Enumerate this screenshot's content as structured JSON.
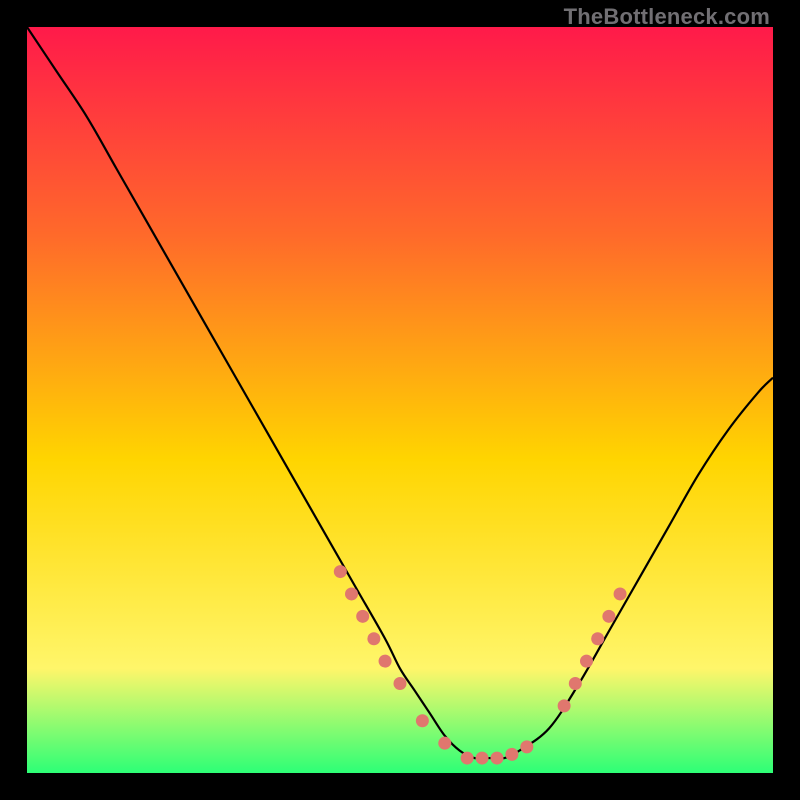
{
  "watermark": "TheBottleneck.com",
  "colors": {
    "gradient_top": "#ff1a4a",
    "gradient_mid_upper": "#ff6a2a",
    "gradient_mid": "#ffd500",
    "gradient_lower": "#fff66a",
    "gradient_bottom": "#2dff76",
    "curve": "#000000",
    "dots": "#e0776e",
    "frame_bg": "#000000"
  },
  "chart_data": {
    "type": "line",
    "title": "",
    "xlabel": "",
    "ylabel": "",
    "xlim": [
      0,
      100
    ],
    "ylim": [
      0,
      100
    ],
    "grid": false,
    "legend": false,
    "series": [
      {
        "name": "bottleneck-curve",
        "x": [
          0,
          4,
          8,
          12,
          16,
          20,
          24,
          28,
          32,
          36,
          40,
          44,
          48,
          50,
          52,
          54,
          56,
          58,
          60,
          62,
          64,
          66,
          70,
          74,
          78,
          82,
          86,
          90,
          94,
          98,
          100
        ],
        "y": [
          100,
          94,
          88,
          81,
          74,
          67,
          60,
          53,
          46,
          39,
          32,
          25,
          18,
          14,
          11,
          8,
          5,
          3,
          2,
          2,
          2,
          3,
          6,
          12,
          19,
          26,
          33,
          40,
          46,
          51,
          53
        ]
      }
    ],
    "highlight_points": {
      "name": "marked-dots",
      "x": [
        42,
        43.5,
        45,
        46.5,
        48,
        50,
        53,
        56,
        59,
        61,
        63,
        65,
        67,
        72,
        73.5,
        75,
        76.5,
        78,
        79.5
      ],
      "y": [
        27,
        24,
        21,
        18,
        15,
        12,
        7,
        4,
        2,
        2,
        2,
        2.5,
        3.5,
        9,
        12,
        15,
        18,
        21,
        24
      ]
    }
  }
}
